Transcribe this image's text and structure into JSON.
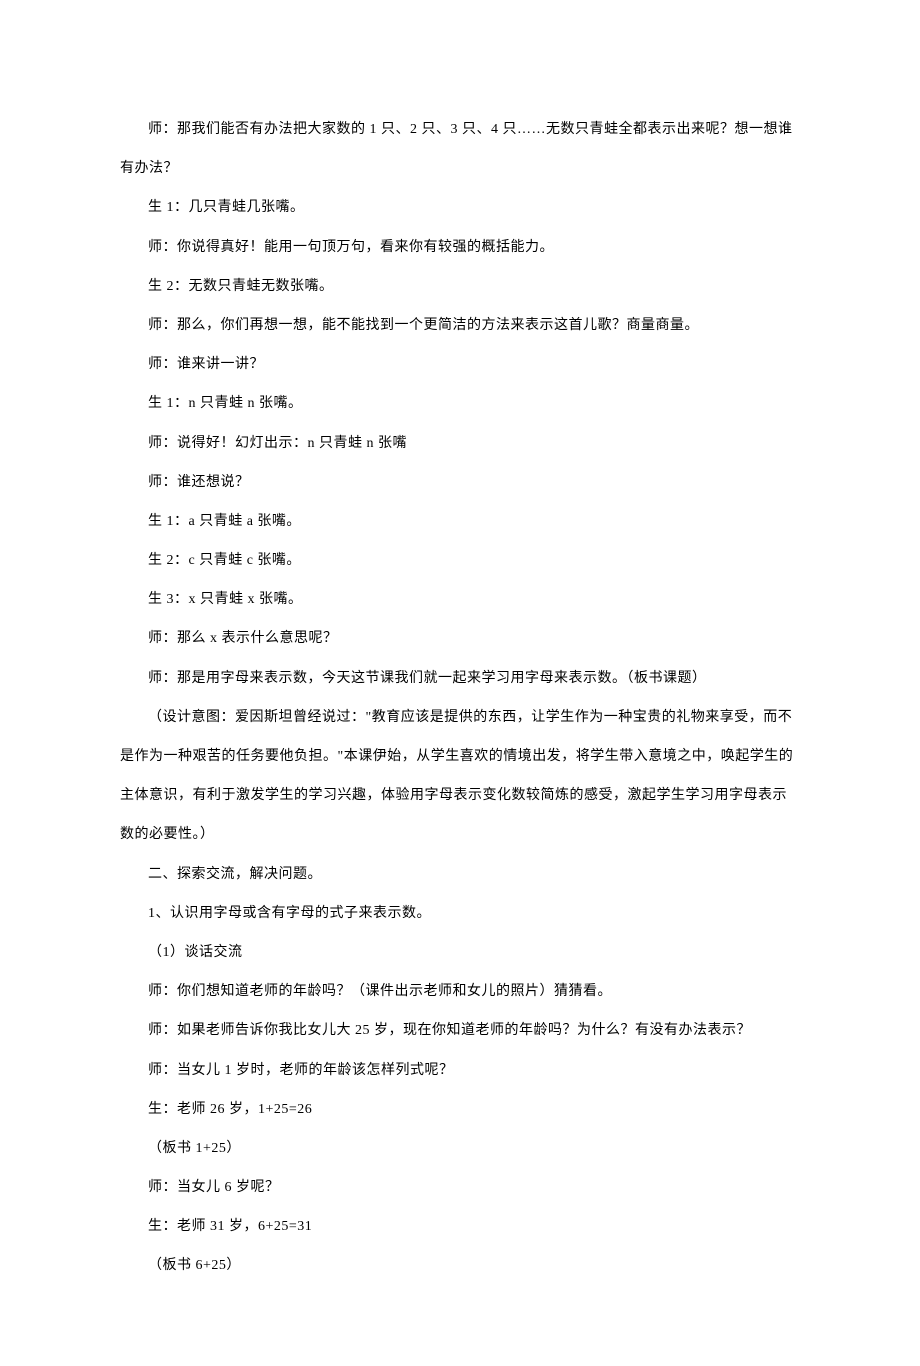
{
  "paragraphs": [
    "师：那我们能否有办法把大家数的 1 只、2 只、3 只、4 只……无数只青蛙全都表示出来呢？想一想谁有办法？",
    "生 1：几只青蛙几张嘴。",
    "师：你说得真好！能用一句顶万句，看来你有较强的概括能力。",
    "生 2：无数只青蛙无数张嘴。",
    "师：那么，你们再想一想，能不能找到一个更简洁的方法来表示这首儿歌？商量商量。",
    "师：谁来讲一讲？",
    "生 1：n 只青蛙 n 张嘴。",
    "师：说得好！幻灯出示：n 只青蛙 n 张嘴",
    "师：谁还想说？",
    "生 1：a 只青蛙 a 张嘴。",
    "生 2：c 只青蛙 c 张嘴。",
    "生 3：x 只青蛙 x 张嘴。",
    "师：那么 x 表示什么意思呢？",
    "师：那是用字母来表示数，今天这节课我们就一起来学习用字母来表示数。（板书课题）",
    "（设计意图：爱因斯坦曾经说过：\"教育应该是提供的东西，让学生作为一种宝贵的礼物来享受，而不是作为一种艰苦的任务要他负担。\"本课伊始，从学生喜欢的情境出发，将学生带入意境之中，唤起学生的主体意识，有利于激发学生的学习兴趣，体验用字母表示变化数较简炼的感受，激起学生学习用字母表示数的必要性。）",
    "二、探索交流，解决问题。",
    "1、认识用字母或含有字母的式子来表示数。",
    "（1）谈话交流",
    "师：你们想知道老师的年龄吗？（课件出示老师和女儿的照片）猜猜看。",
    "师：如果老师告诉你我比女儿大 25 岁，现在你知道老师的年龄吗？为什么？有没有办法表示？",
    "师：当女儿 1 岁时，老师的年龄该怎样列式呢？",
    "生：老师 26 岁，1+25=26",
    "（板书 1+25）",
    "师：当女儿 6 岁呢？",
    "生：老师 31 岁，6+25=31",
    "（板书 6+25）"
  ]
}
